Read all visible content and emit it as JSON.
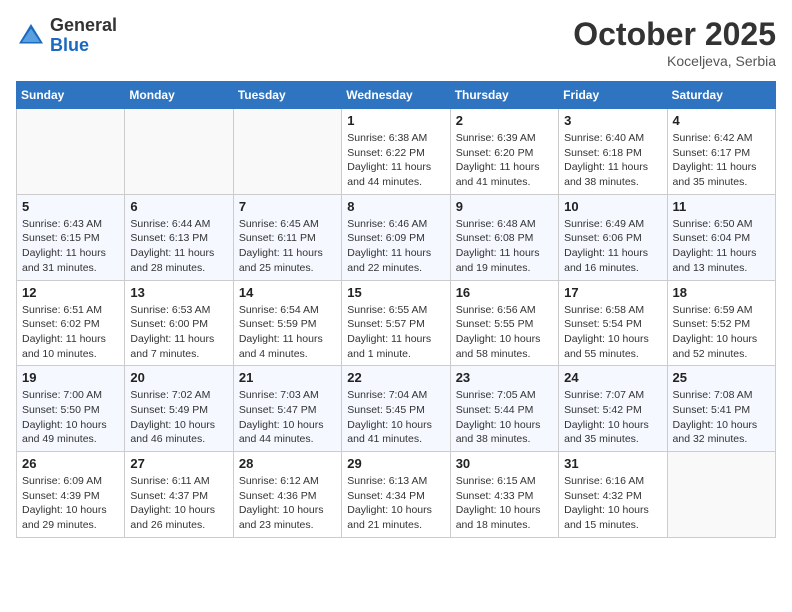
{
  "header": {
    "logo_general": "General",
    "logo_blue": "Blue",
    "month": "October 2025",
    "location": "Koceljeva, Serbia"
  },
  "weekdays": [
    "Sunday",
    "Monday",
    "Tuesday",
    "Wednesday",
    "Thursday",
    "Friday",
    "Saturday"
  ],
  "weeks": [
    [
      {
        "day": "",
        "info": ""
      },
      {
        "day": "",
        "info": ""
      },
      {
        "day": "",
        "info": ""
      },
      {
        "day": "1",
        "info": "Sunrise: 6:38 AM\nSunset: 6:22 PM\nDaylight: 11 hours\nand 44 minutes."
      },
      {
        "day": "2",
        "info": "Sunrise: 6:39 AM\nSunset: 6:20 PM\nDaylight: 11 hours\nand 41 minutes."
      },
      {
        "day": "3",
        "info": "Sunrise: 6:40 AM\nSunset: 6:18 PM\nDaylight: 11 hours\nand 38 minutes."
      },
      {
        "day": "4",
        "info": "Sunrise: 6:42 AM\nSunset: 6:17 PM\nDaylight: 11 hours\nand 35 minutes."
      }
    ],
    [
      {
        "day": "5",
        "info": "Sunrise: 6:43 AM\nSunset: 6:15 PM\nDaylight: 11 hours\nand 31 minutes."
      },
      {
        "day": "6",
        "info": "Sunrise: 6:44 AM\nSunset: 6:13 PM\nDaylight: 11 hours\nand 28 minutes."
      },
      {
        "day": "7",
        "info": "Sunrise: 6:45 AM\nSunset: 6:11 PM\nDaylight: 11 hours\nand 25 minutes."
      },
      {
        "day": "8",
        "info": "Sunrise: 6:46 AM\nSunset: 6:09 PM\nDaylight: 11 hours\nand 22 minutes."
      },
      {
        "day": "9",
        "info": "Sunrise: 6:48 AM\nSunset: 6:08 PM\nDaylight: 11 hours\nand 19 minutes."
      },
      {
        "day": "10",
        "info": "Sunrise: 6:49 AM\nSunset: 6:06 PM\nDaylight: 11 hours\nand 16 minutes."
      },
      {
        "day": "11",
        "info": "Sunrise: 6:50 AM\nSunset: 6:04 PM\nDaylight: 11 hours\nand 13 minutes."
      }
    ],
    [
      {
        "day": "12",
        "info": "Sunrise: 6:51 AM\nSunset: 6:02 PM\nDaylight: 11 hours\nand 10 minutes."
      },
      {
        "day": "13",
        "info": "Sunrise: 6:53 AM\nSunset: 6:00 PM\nDaylight: 11 hours\nand 7 minutes."
      },
      {
        "day": "14",
        "info": "Sunrise: 6:54 AM\nSunset: 5:59 PM\nDaylight: 11 hours\nand 4 minutes."
      },
      {
        "day": "15",
        "info": "Sunrise: 6:55 AM\nSunset: 5:57 PM\nDaylight: 11 hours\nand 1 minute."
      },
      {
        "day": "16",
        "info": "Sunrise: 6:56 AM\nSunset: 5:55 PM\nDaylight: 10 hours\nand 58 minutes."
      },
      {
        "day": "17",
        "info": "Sunrise: 6:58 AM\nSunset: 5:54 PM\nDaylight: 10 hours\nand 55 minutes."
      },
      {
        "day": "18",
        "info": "Sunrise: 6:59 AM\nSunset: 5:52 PM\nDaylight: 10 hours\nand 52 minutes."
      }
    ],
    [
      {
        "day": "19",
        "info": "Sunrise: 7:00 AM\nSunset: 5:50 PM\nDaylight: 10 hours\nand 49 minutes."
      },
      {
        "day": "20",
        "info": "Sunrise: 7:02 AM\nSunset: 5:49 PM\nDaylight: 10 hours\nand 46 minutes."
      },
      {
        "day": "21",
        "info": "Sunrise: 7:03 AM\nSunset: 5:47 PM\nDaylight: 10 hours\nand 44 minutes."
      },
      {
        "day": "22",
        "info": "Sunrise: 7:04 AM\nSunset: 5:45 PM\nDaylight: 10 hours\nand 41 minutes."
      },
      {
        "day": "23",
        "info": "Sunrise: 7:05 AM\nSunset: 5:44 PM\nDaylight: 10 hours\nand 38 minutes."
      },
      {
        "day": "24",
        "info": "Sunrise: 7:07 AM\nSunset: 5:42 PM\nDaylight: 10 hours\nand 35 minutes."
      },
      {
        "day": "25",
        "info": "Sunrise: 7:08 AM\nSunset: 5:41 PM\nDaylight: 10 hours\nand 32 minutes."
      }
    ],
    [
      {
        "day": "26",
        "info": "Sunrise: 6:09 AM\nSunset: 4:39 PM\nDaylight: 10 hours\nand 29 minutes."
      },
      {
        "day": "27",
        "info": "Sunrise: 6:11 AM\nSunset: 4:37 PM\nDaylight: 10 hours\nand 26 minutes."
      },
      {
        "day": "28",
        "info": "Sunrise: 6:12 AM\nSunset: 4:36 PM\nDaylight: 10 hours\nand 23 minutes."
      },
      {
        "day": "29",
        "info": "Sunrise: 6:13 AM\nSunset: 4:34 PM\nDaylight: 10 hours\nand 21 minutes."
      },
      {
        "day": "30",
        "info": "Sunrise: 6:15 AM\nSunset: 4:33 PM\nDaylight: 10 hours\nand 18 minutes."
      },
      {
        "day": "31",
        "info": "Sunrise: 6:16 AM\nSunset: 4:32 PM\nDaylight: 10 hours\nand 15 minutes."
      },
      {
        "day": "",
        "info": ""
      }
    ]
  ]
}
